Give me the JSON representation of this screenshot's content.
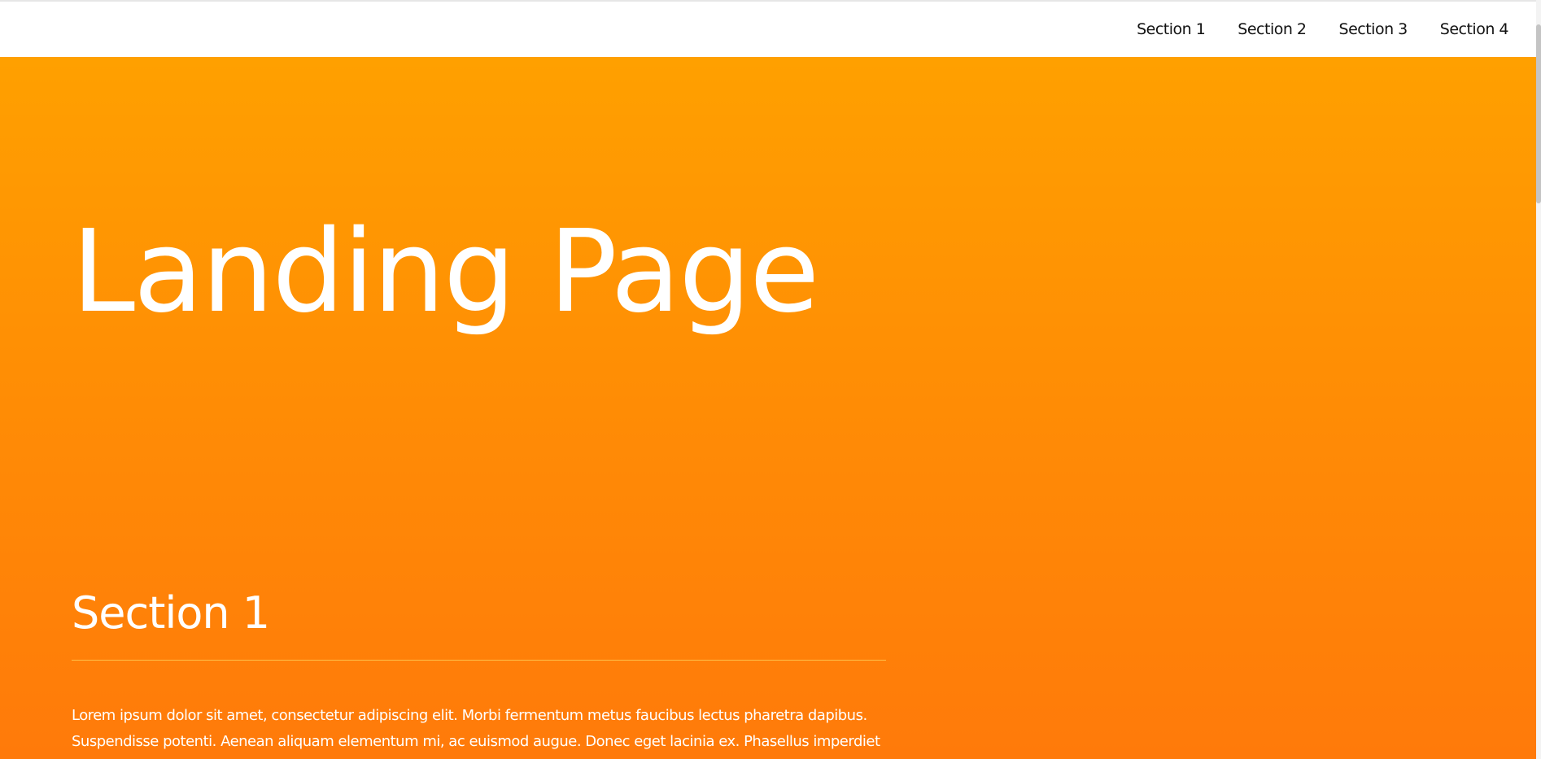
{
  "nav": {
    "items": [
      {
        "label": "Section 1"
      },
      {
        "label": "Section 2"
      },
      {
        "label": "Section 3"
      },
      {
        "label": "Section 4"
      }
    ]
  },
  "hero": {
    "title": "Landing Page"
  },
  "section1": {
    "heading": "Section 1",
    "text": "Lorem ipsum dolor sit amet, consectetur adipiscing elit. Morbi fermentum metus faucibus lectus pharetra dapibus. Suspendisse potenti. Aenean aliquam elementum mi, ac euismod augue. Donec eget lacinia ex. Phasellus imperdiet"
  },
  "colors": {
    "gradient_top": "#ffa000",
    "gradient_bottom": "#ff7a0a",
    "nav_background": "#ffffff",
    "nav_text": "#111111",
    "text_on_hero": "#ffffff"
  }
}
